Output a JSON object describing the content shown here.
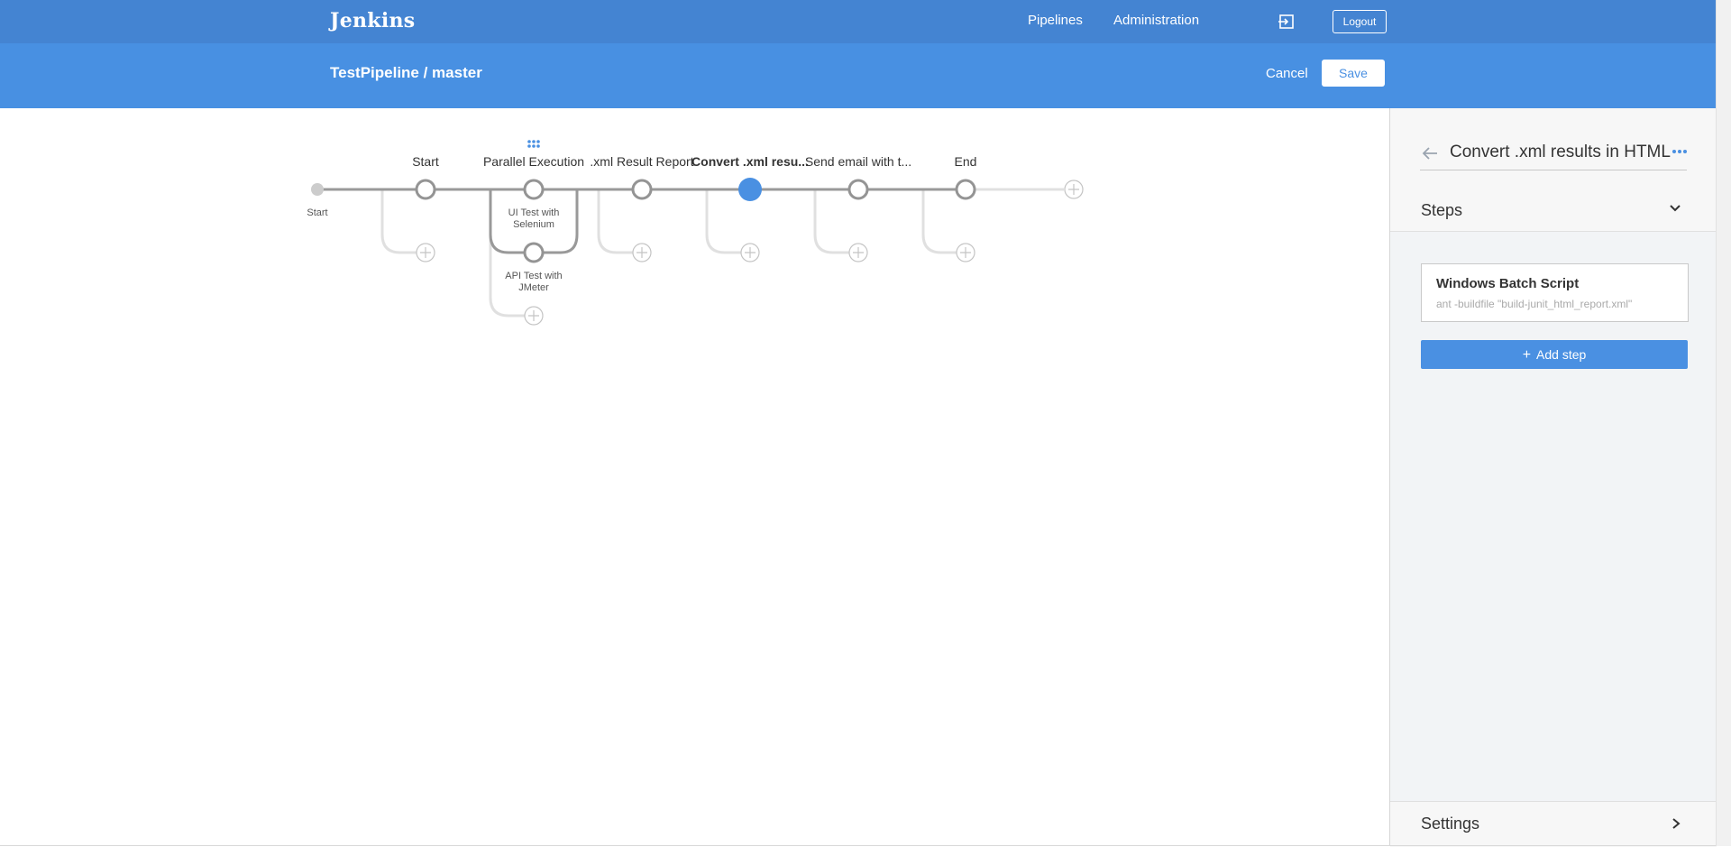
{
  "header": {
    "logo": "Jenkins",
    "nav": [
      "Pipelines",
      "Administration"
    ],
    "logout_label": "Logout",
    "icons": {
      "exit": "exit-icon"
    }
  },
  "subheader": {
    "breadcrumb": "TestPipeline / master",
    "cancel_label": "Cancel",
    "save_label": "Save"
  },
  "pipeline": {
    "start_label": "Start",
    "stages": [
      {
        "label": "Start",
        "selected": false
      },
      {
        "label": "Parallel Execution",
        "selected": false,
        "branches": [
          "UI Test with Selenium",
          "API Test with JMeter"
        ]
      },
      {
        "label": ".xml Result Report",
        "selected": false
      },
      {
        "label": "Convert .xml resu...",
        "selected": true
      },
      {
        "label": "Send email with t...",
        "selected": false
      },
      {
        "label": "End",
        "selected": false
      }
    ],
    "branch_labels": {
      "b1_line1": "UI Test with",
      "b1_line2": "Selenium",
      "b2_line1": "API Test with",
      "b2_line2": "JMeter"
    },
    "icons": {
      "drag": "drag-handle-icon",
      "add": "add-stage-icon"
    },
    "colors": {
      "selected": "#4a90e2",
      "line": "#999999",
      "faint": "#e0e0e0"
    }
  },
  "panel": {
    "title": "Convert .xml results in HTML",
    "steps_label": "Steps",
    "step": {
      "title": "Windows Batch Script",
      "command": "ant -buildfile \"build-junit_html_report.xml\""
    },
    "add_step_label": "Add step",
    "settings_label": "Settings"
  }
}
